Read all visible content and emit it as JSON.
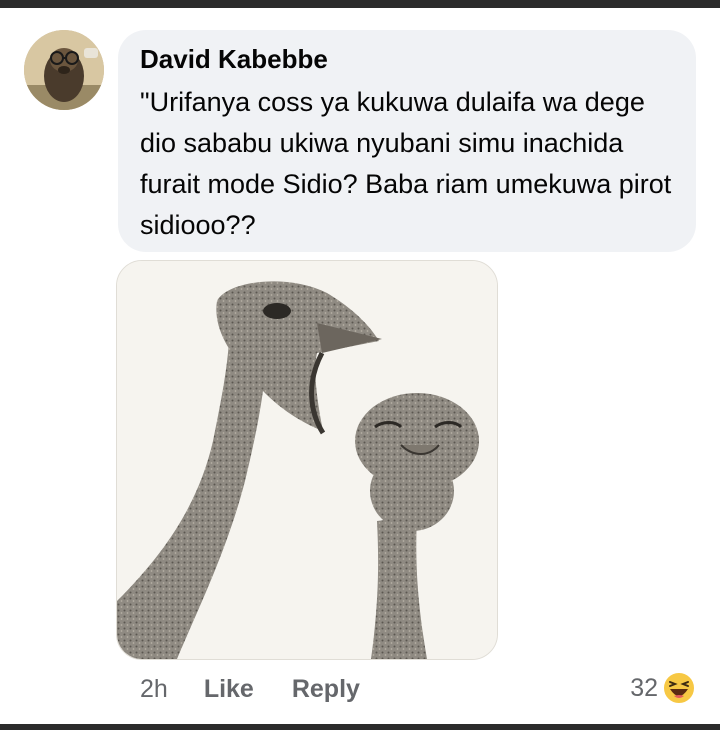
{
  "comment": {
    "author": "David Kabebbe",
    "text": "\"Urifanya coss ya kukuwa dulaifa wa dege dio sababu ukiwa nyubani simu inachida furait mode Sidio? Baba riam umekuwa pirot sidiooo??",
    "timestamp": "2h",
    "like_label": "Like",
    "reply_label": "Reply",
    "reaction_count": "32",
    "reaction_icon": "haha-laughing-emoji-icon"
  },
  "colors": {
    "bubble_background": "#f0f2f5",
    "action_text": "#65676b",
    "author_text": "#050505",
    "reaction_yellow": "#f7c844"
  }
}
